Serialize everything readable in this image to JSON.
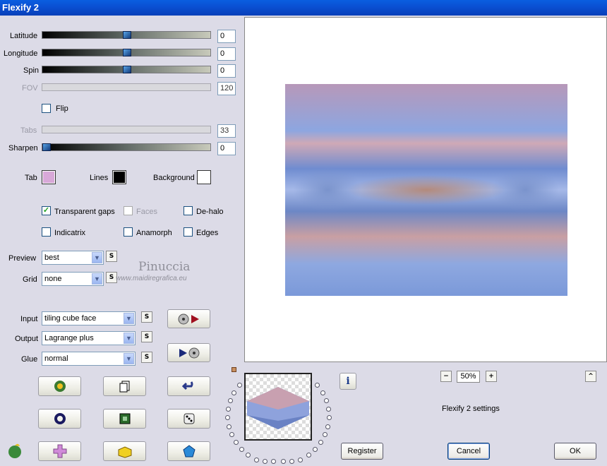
{
  "window": {
    "title": "Flexify 2"
  },
  "controls": {
    "latitude": {
      "label": "Latitude",
      "value": "0",
      "position": 0.5
    },
    "longitude": {
      "label": "Longitude",
      "value": "0",
      "position": 0.5
    },
    "spin": {
      "label": "Spin",
      "value": "0",
      "position": 0.5
    },
    "fov": {
      "label": "FOV",
      "value": "120"
    },
    "flip": {
      "label": "Flip",
      "checked": false
    },
    "tabs": {
      "label": "Tabs",
      "value": "33"
    },
    "sharpen": {
      "label": "Sharpen",
      "value": "0",
      "position": 0
    }
  },
  "colors": {
    "tab_label": "Tab",
    "tab_color": "#d8a8d8",
    "lines_label": "Lines",
    "lines_color": "#000000",
    "background_label": "Background",
    "background_color": "#ffffff"
  },
  "options": {
    "transparent_gaps": "Transparent gaps",
    "faces": "Faces",
    "dehalo": "De-halo",
    "indicatrix": "Indicatrix",
    "anamorph": "Anamorph",
    "edges": "Edges"
  },
  "preview": {
    "label": "Preview",
    "value": "best",
    "s": "S"
  },
  "grid": {
    "label": "Grid",
    "value": "none",
    "s": "S"
  },
  "watermark": {
    "name": "Pinuccia",
    "site": "www.maidiregrafica.eu"
  },
  "input": {
    "label": "Input",
    "value": "tiling cube face",
    "s": "S"
  },
  "output": {
    "label": "Output",
    "value": "Lagrange plus",
    "s": "S"
  },
  "glue": {
    "label": "Glue",
    "value": "normal",
    "s": "S"
  },
  "zoom": {
    "minus": "−",
    "value": "50%",
    "plus": "+",
    "up": "^"
  },
  "info_icon": "i",
  "settings_text": "Flexify 2 settings",
  "buttons": {
    "register": "Register",
    "cancel": "Cancel",
    "ok": "OK"
  }
}
